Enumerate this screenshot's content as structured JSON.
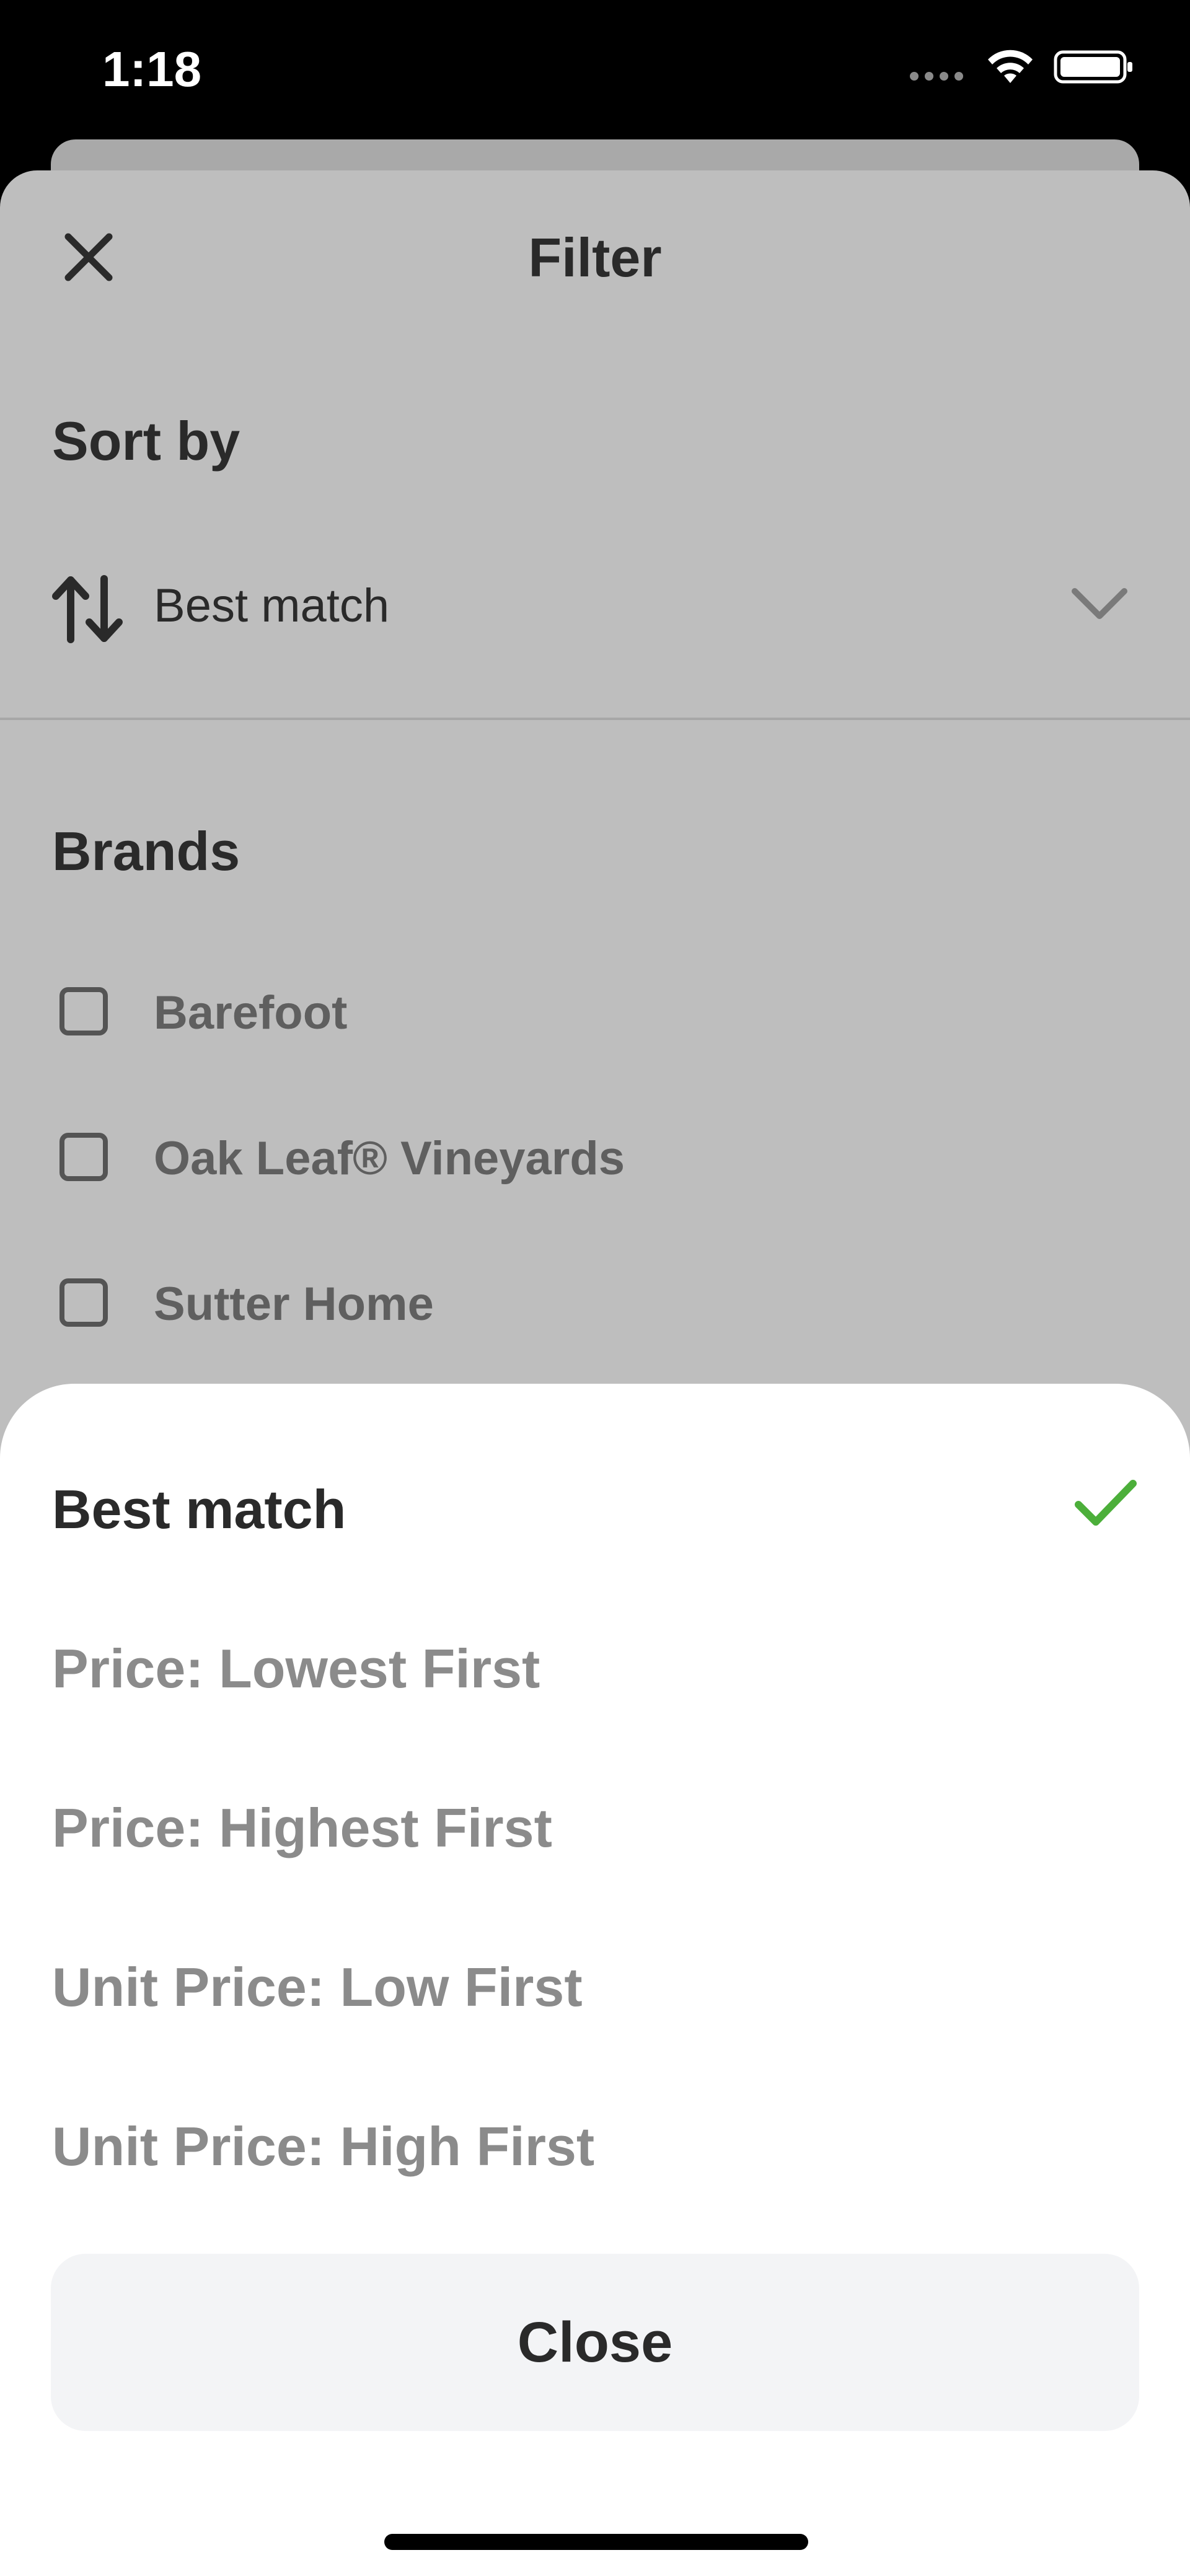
{
  "status_bar": {
    "time": "1:18"
  },
  "filter_panel": {
    "title": "Filter",
    "sort_heading": "Sort by",
    "sort_value": "Best match",
    "brands_heading": "Brands",
    "brands": [
      {
        "label": "Barefoot",
        "checked": false
      },
      {
        "label": "Oak Leaf® Vineyards",
        "checked": false
      },
      {
        "label": "Sutter Home",
        "checked": false
      }
    ]
  },
  "sort_sheet": {
    "options": [
      {
        "label": "Best match",
        "selected": true
      },
      {
        "label": "Price: Lowest First",
        "selected": false
      },
      {
        "label": "Price: Highest First",
        "selected": false
      },
      {
        "label": "Unit Price: Low First",
        "selected": false
      },
      {
        "label": "Unit Price: High First",
        "selected": false
      }
    ],
    "close_label": "Close",
    "accent_color": "#4caf3a"
  },
  "icons": {
    "close": "close-icon",
    "sort": "sort-arrows-icon",
    "chevron": "chevron-down-icon",
    "check": "checkmark-icon",
    "wifi": "wifi-icon",
    "battery": "battery-icon"
  }
}
